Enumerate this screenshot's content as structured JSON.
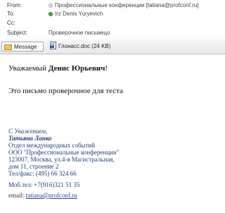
{
  "header": {
    "from_label": "From:",
    "from_value": "Профессиональные конференции [tatiana@profconf.ru]",
    "to_label": "To:",
    "to_value": "Irz Denis Yuryevich",
    "cc_label": "Cc:",
    "cc_value": "",
    "subject_label": "Subject:",
    "subject_value": "Проверочное письмецо"
  },
  "attachments": {
    "message_tab": "Message",
    "file_tab": "Глонасс.doc (24 KB)"
  },
  "body": {
    "greeting_prefix": "Уважаемый ",
    "greeting_name": "Денис Юрьевич",
    "greeting_suffix": "!",
    "text": "Это письмо проверочное для теста"
  },
  "signature": {
    "line1": "С Уважением,",
    "line2": "Татьяна Ланко",
    "line3": "Отдел международных событий",
    "line4": "ООО \"Профессиональные конференции\"",
    "line5": "123007, Москва, ул.4-я Магистральная,",
    "line6": "дом 11, строение 2",
    "line7": "Тел/факс: (495) 66 324 66",
    "line8": "Моб.тел: +7(916)321 51 35",
    "email_label": "email: ",
    "email": "tatiana@profconf.ru"
  },
  "colors": {
    "signature_blue": "#1f3f7a",
    "link_blue": "#2a3f9a",
    "recipient_dot": "#3faa3f"
  }
}
